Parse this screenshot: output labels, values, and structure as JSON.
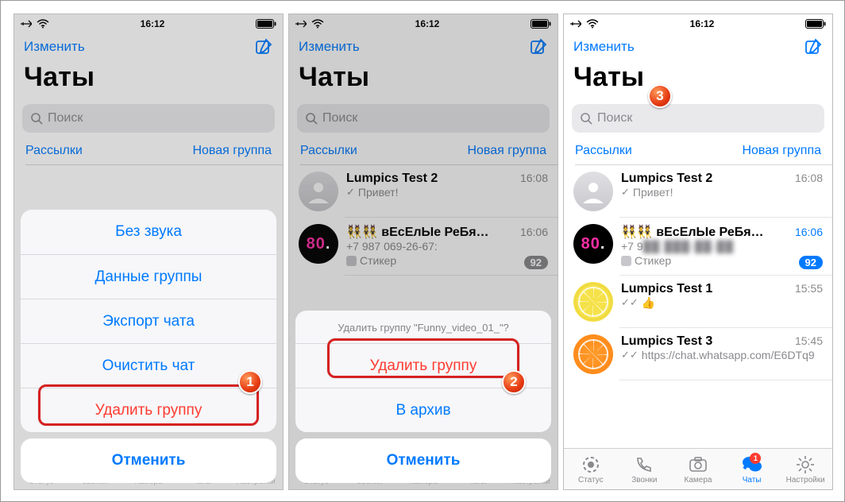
{
  "statusbar": {
    "time": "16:12"
  },
  "header": {
    "edit": "Изменить",
    "title": "Чаты"
  },
  "search": {
    "placeholder": "Поиск"
  },
  "subheader": {
    "broadcasts": "Рассылки",
    "newgroup": "Новая группа"
  },
  "actionsheet1": {
    "mute": "Без звука",
    "groupinfo": "Данные группы",
    "export": "Экспорт чата",
    "clear": "Очистить чат",
    "delete": "Удалить группу",
    "cancel": "Отменить"
  },
  "actionsheet2": {
    "title": "Удалить группу \"Funny_video_01_\"?",
    "delete": "Удалить группу",
    "archive": "В архив",
    "cancel": "Отменить"
  },
  "chats": {
    "c1": {
      "name": "Lumpics Test 2",
      "time": "16:08",
      "msg": "Привет!"
    },
    "c2": {
      "name": "вЕсЕлЫе РеБя…",
      "time": "16:06",
      "phone_full": "+7 987 069-26-67:",
      "phone_masked": "+7 9",
      "sticker": "Стикер",
      "badge": "92",
      "emoji": "👯👯"
    },
    "c3": {
      "name": "Lumpics Test 1",
      "time": "15:55",
      "msg": "👍"
    },
    "c4": {
      "name": "Lumpics Test 3",
      "time": "15:45",
      "msg": "https://chat.whatsapp.com/E6DTq9"
    }
  },
  "tabs": {
    "status": "Статус",
    "calls": "Звонки",
    "camera": "Камера",
    "chats": "Чаты",
    "settings": "Настройки",
    "chat_badge": "1"
  },
  "badges": {
    "b1": "1",
    "b2": "2",
    "b3": "3"
  }
}
